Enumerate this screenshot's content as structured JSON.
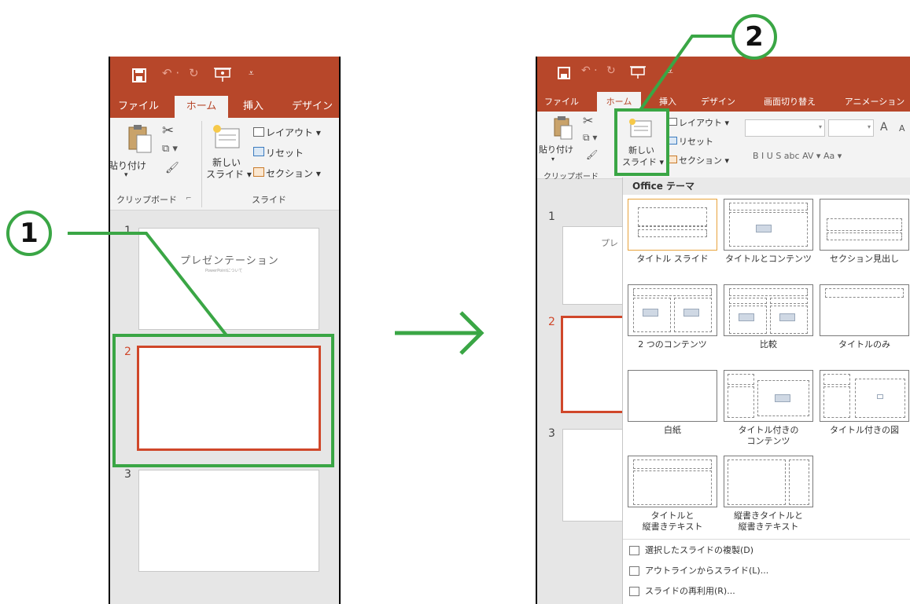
{
  "left": {
    "tabs": [
      "ファイル",
      "ホーム",
      "挿入",
      "デザイン"
    ],
    "ribbon": {
      "paste": "貼り付け",
      "new_slide_1": "新しい",
      "new_slide_2": "スライド ▾",
      "layout": "レイアウト ▾",
      "reset": "リセット",
      "section": "セクション ▾",
      "clipboard_group": "クリップボード",
      "slide_group": "スライド"
    },
    "slides": [
      {
        "num": "1",
        "title": "プレゼンテーション",
        "subtitle": "PowerPointについて"
      },
      {
        "num": "2"
      },
      {
        "num": "3"
      }
    ]
  },
  "right": {
    "tabs": [
      "ファイル",
      "ホーム",
      "挿入",
      "デザイン",
      "画面切り替え",
      "アニメーション"
    ],
    "ribbon": {
      "paste": "貼り付け",
      "new_slide_1": "新しい",
      "new_slide_2": "スライド ▾",
      "layout": "レイアウト ▾",
      "reset": "リセット",
      "section": "セクション ▾",
      "clipboard_group": "クリップボード",
      "format_buttons": "B  I  U  S  abc  AV ▾  Aa ▾",
      "font_size_up": "A",
      "font_size_down": "A"
    },
    "slides": [
      {
        "num": "1",
        "title": "プレ"
      },
      {
        "num": "2"
      },
      {
        "num": "3"
      }
    ],
    "gallery": {
      "header": "Office テーマ",
      "layouts": [
        {
          "name": "タイトル スライド"
        },
        {
          "name": "タイトルとコンテンツ"
        },
        {
          "name": "セクション見出し"
        },
        {
          "name": "2 つのコンテンツ"
        },
        {
          "name": "比較"
        },
        {
          "name": "タイトルのみ"
        },
        {
          "name": "白紙"
        },
        {
          "name": "タイトル付きの\nコンテンツ"
        },
        {
          "name": "タイトル付きの図"
        },
        {
          "name": "タイトルと\n縦書きテキスト"
        },
        {
          "name": "縦書きタイトルと\n縦書きテキスト"
        }
      ],
      "menu": [
        "選択したスライドの複製(D)",
        "アウトラインからスライド(L)...",
        "スライドの再利用(R)..."
      ]
    }
  },
  "annotations": {
    "step1": "1",
    "step2": "2"
  },
  "colors": {
    "accent": "#b7472a",
    "highlight": "#3aa645"
  }
}
